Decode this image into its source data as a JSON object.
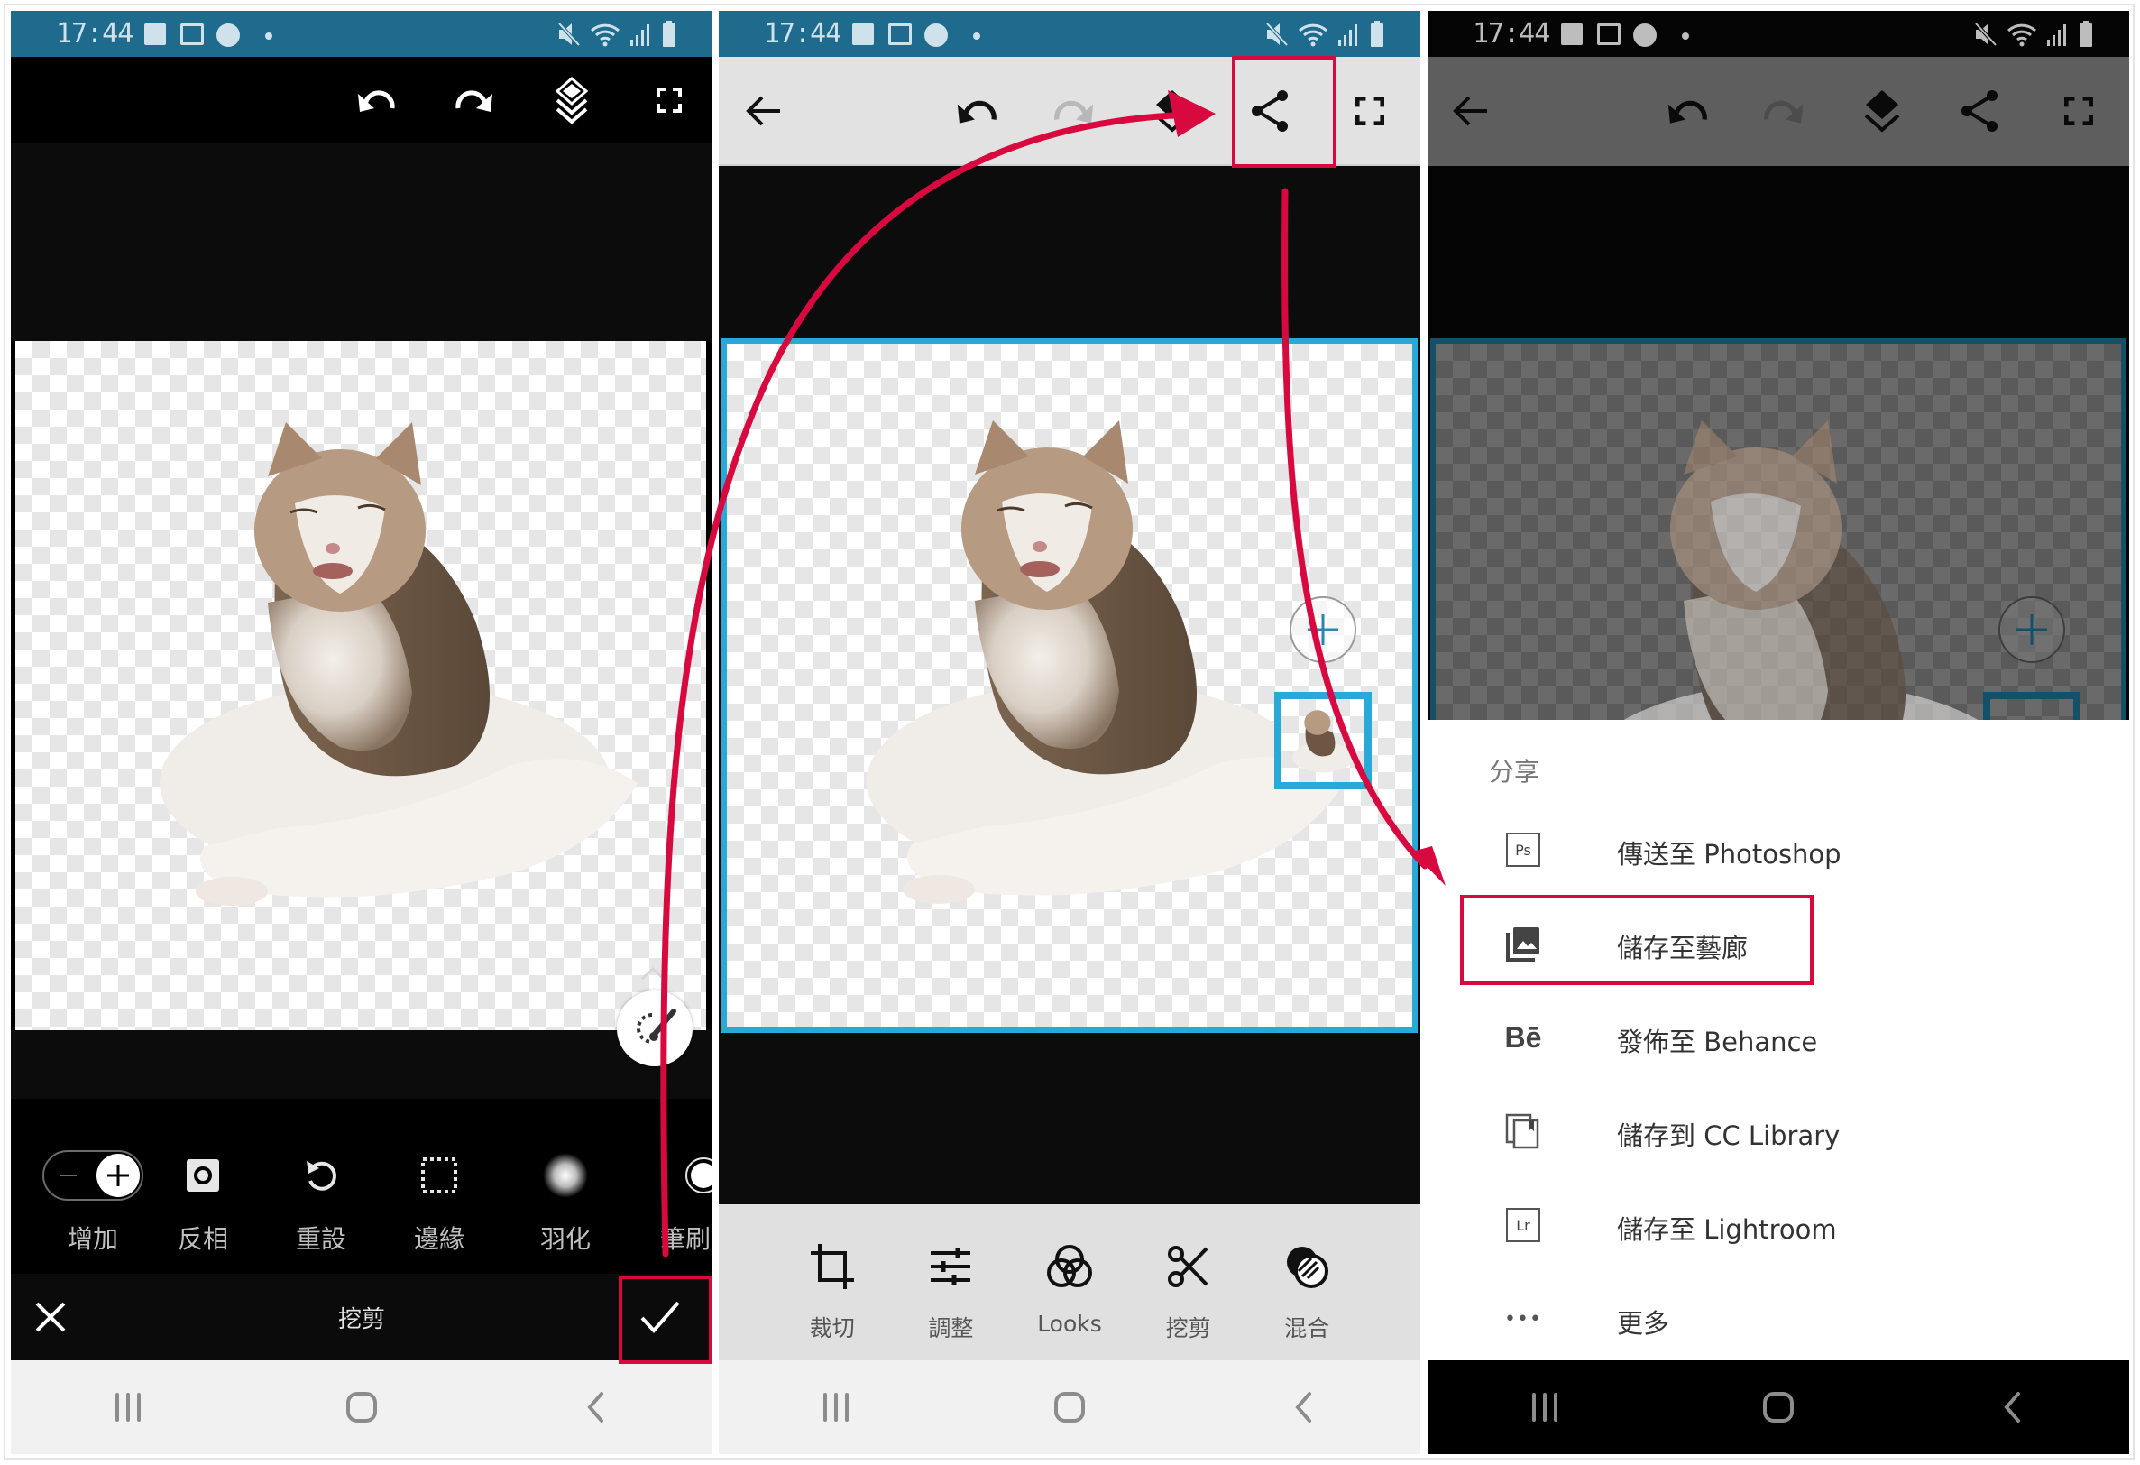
{
  "status_bar": {
    "time": "17:44",
    "left_icons": [
      "gallery-icon",
      "gmail-icon",
      "line-icon",
      "dot-icon"
    ],
    "right_icons": [
      "mute-icon",
      "wifi-icon",
      "signal-icon",
      "battery-icon"
    ]
  },
  "panel_left": {
    "toolbar": {
      "icons": [
        "undo-icon",
        "redo-icon",
        "layers-icon",
        "fullscreen-icon"
      ]
    },
    "tools": [
      {
        "label": "增加",
        "icon": "add-subtract-toggle"
      },
      {
        "label": "反相",
        "icon": "invert-icon"
      },
      {
        "label": "重設",
        "icon": "reset-icon"
      },
      {
        "label": "邊緣",
        "icon": "edge-icon"
      },
      {
        "label": "羽化",
        "icon": "feather-icon"
      },
      {
        "label": "筆刷大小",
        "icon": "brush-size-icon"
      }
    ],
    "action_bar": {
      "title": "挖剪",
      "cancel_icon": "close-icon",
      "confirm_icon": "check-icon"
    },
    "brush_button_icon": "brush-select-icon"
  },
  "panel_middle": {
    "toolbar": {
      "icons": [
        "back-arrow-icon",
        "undo-icon",
        "redo-icon",
        "layers-icon",
        "share-icon",
        "fullscreen-icon"
      ],
      "redo_enabled": false
    },
    "bottom_tools": [
      {
        "label": "裁切",
        "icon": "crop-icon"
      },
      {
        "label": "調整",
        "icon": "adjust-icon"
      },
      {
        "label": "Looks",
        "icon": "looks-icon"
      },
      {
        "label": "挖剪",
        "icon": "cutout-icon"
      },
      {
        "label": "混合",
        "icon": "blend-icon"
      }
    ],
    "add_layer_icon": "plus-icon"
  },
  "panel_right": {
    "share_sheet": {
      "title": "分享",
      "items": [
        {
          "label": "傳送至 Photoshop",
          "icon": "photoshop-icon",
          "icon_text": "Ps"
        },
        {
          "label": "儲存至藝廊",
          "icon": "gallery-save-icon",
          "icon_text": "",
          "highlighted": true
        },
        {
          "label": "發佈至 Behance",
          "icon": "behance-icon",
          "icon_text": "Bē"
        },
        {
          "label": "儲存到 CC Library",
          "icon": "cc-library-icon",
          "icon_text": ""
        },
        {
          "label": "儲存至 Lightroom",
          "icon": "lightroom-icon",
          "icon_text": "Lr"
        },
        {
          "label": "更多",
          "icon": "more-icon",
          "icon_text": "•••"
        }
      ]
    }
  },
  "navigation": {
    "buttons": [
      "recents-icon",
      "home-icon",
      "back-icon"
    ]
  },
  "colors": {
    "status_bar": "#1f6b8e",
    "highlight": "#d8093f",
    "selection_border": "#29a9d8"
  }
}
